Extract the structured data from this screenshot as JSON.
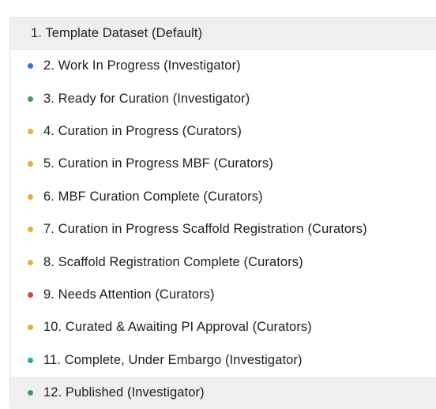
{
  "status_list": {
    "items": [
      {
        "label": "1. Template Dataset (Default)",
        "dot_color": null
      },
      {
        "label": "2. Work In Progress (Investigator)",
        "dot_color": "#2f6fe0"
      },
      {
        "label": "3. Ready for Curation (Investigator)",
        "dot_color": "#3f9d5b"
      },
      {
        "label": "4. Curation in Progress (Curators)",
        "dot_color": "#f0a840"
      },
      {
        "label": "5. Curation in Progress MBF (Curators)",
        "dot_color": "#f0a840"
      },
      {
        "label": "6. MBF Curation Complete (Curators)",
        "dot_color": "#f0a840"
      },
      {
        "label": "7. Curation in Progress Scaffold Registration (Curators)",
        "dot_color": "#f0a840"
      },
      {
        "label": "8. Scaffold Registration Complete (Curators)",
        "dot_color": "#f0a840"
      },
      {
        "label": "9. Needs Attention (Curators)",
        "dot_color": "#d9423f"
      },
      {
        "label": "10. Curated & Awaiting PI Approval (Curators)",
        "dot_color": "#f0a840"
      },
      {
        "label": "11. Complete, Under Embargo (Investigator)",
        "dot_color": "#36a3a0"
      },
      {
        "label": "12. Published (Investigator)",
        "dot_color": "#3f9d5b"
      }
    ]
  }
}
